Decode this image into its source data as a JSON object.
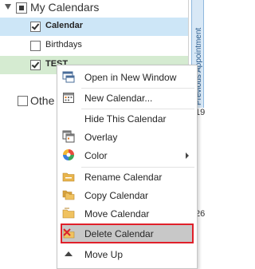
{
  "folder_pane": {
    "group": {
      "label": "My Calendars",
      "calendars": [
        {
          "label": "Calendar",
          "checked": true
        },
        {
          "label": "Birthdays",
          "checked": false
        },
        {
          "label": "TEST",
          "checked": true
        }
      ]
    },
    "other_group_label": "Othe"
  },
  "view_strip": {
    "previous_appointment": "Previous Appointment",
    "numbers": [
      "19",
      "26"
    ]
  },
  "context_menu": {
    "items": [
      {
        "label": "Open in New Window",
        "icon": "new-window-icon"
      },
      {
        "label": "New Calendar...",
        "icon": "new-calendar-icon"
      },
      {
        "label": "Hide This Calendar",
        "icon": ""
      },
      {
        "label": "Overlay",
        "icon": "overlay-icon"
      },
      {
        "label": "Color",
        "icon": "color-palette-icon"
      },
      {
        "label": "Rename Calendar",
        "icon": "rename-folder-icon"
      },
      {
        "label": "Copy Calendar",
        "icon": "copy-folder-icon"
      },
      {
        "label": "Move Calendar",
        "icon": "move-folder-icon"
      },
      {
        "label": "Delete Calendar",
        "icon": "delete-icon"
      },
      {
        "label": "Move Up",
        "icon": "move-up-icon"
      }
    ],
    "highlighted_item": "Delete Calendar",
    "highlight_color": "#e0202a"
  }
}
